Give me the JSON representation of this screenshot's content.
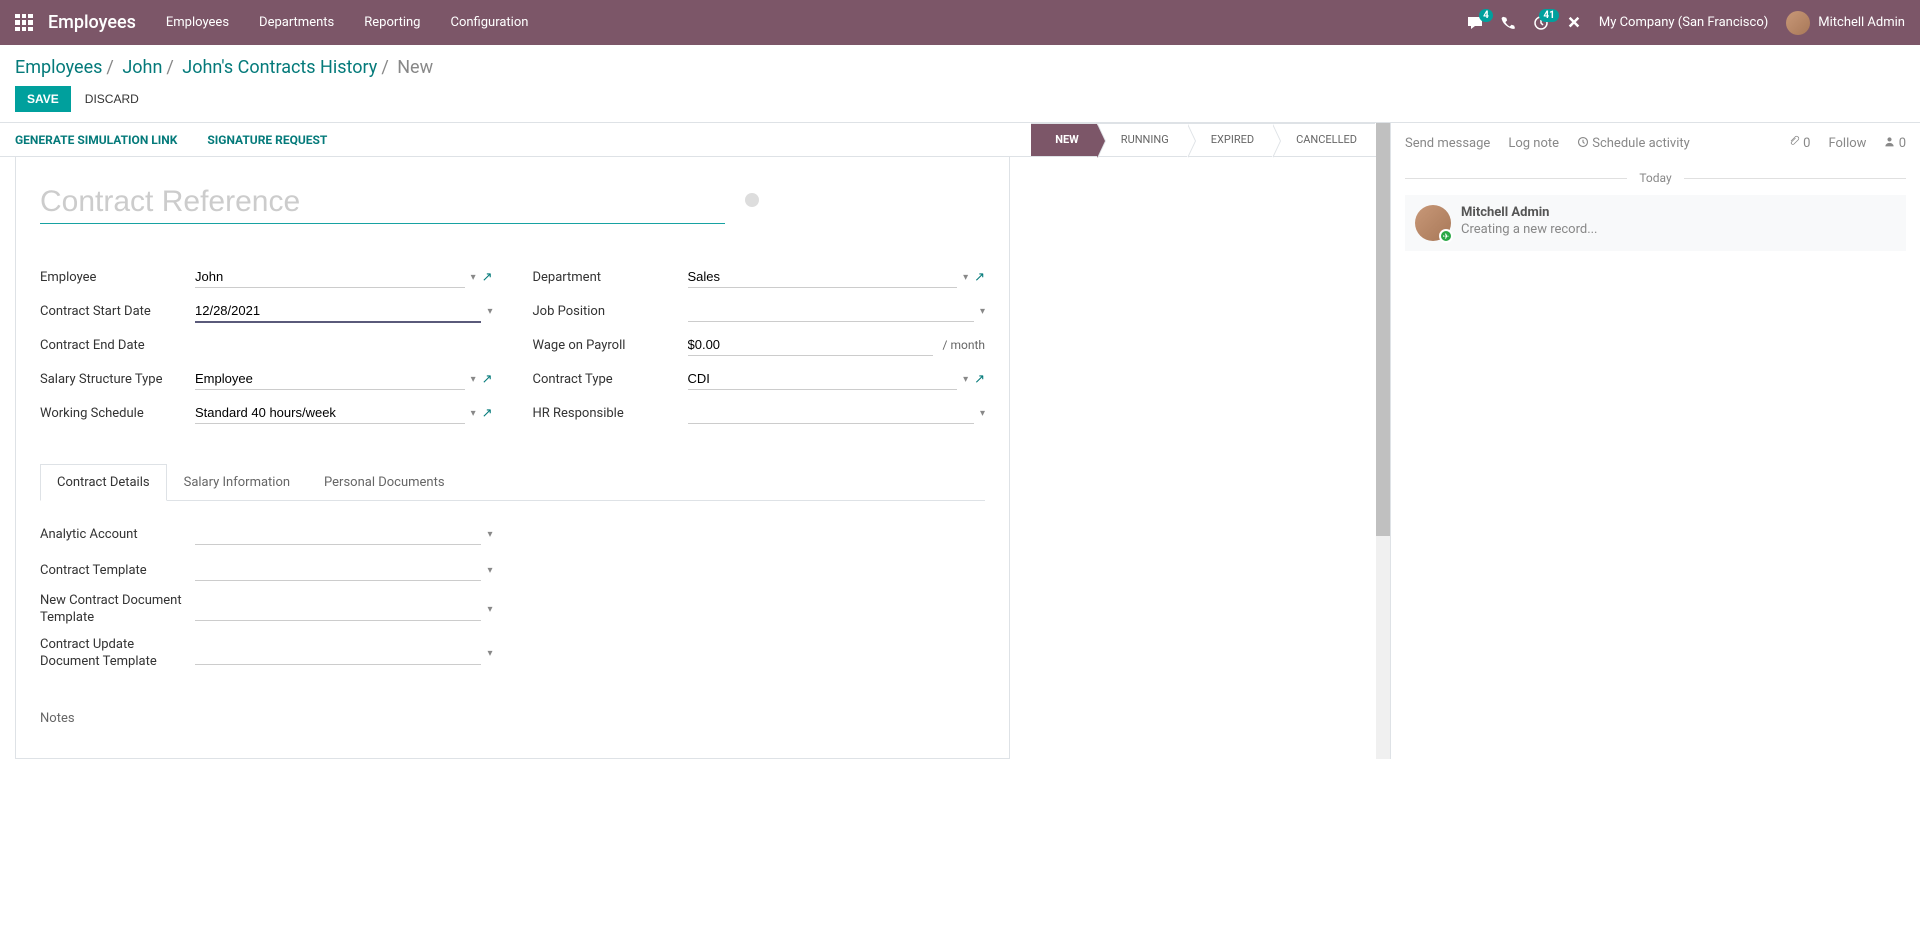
{
  "nav": {
    "module": "Employees",
    "menu": [
      "Employees",
      "Departments",
      "Reporting",
      "Configuration"
    ],
    "messages_badge": "4",
    "activities_badge": "41",
    "company": "My Company (San Francisco)",
    "user": "Mitchell Admin"
  },
  "breadcrumb": {
    "items": [
      "Employees",
      "John",
      "John's Contracts History"
    ],
    "current": "New"
  },
  "buttons": {
    "save": "SAVE",
    "discard": "DISCARD",
    "sim_link": "GENERATE SIMULATION LINK",
    "sig_request": "SIGNATURE REQUEST"
  },
  "status": {
    "steps": [
      "NEW",
      "RUNNING",
      "EXPIRED",
      "CANCELLED"
    ],
    "active": 0
  },
  "form": {
    "title_placeholder": "Contract Reference",
    "left": {
      "employee_label": "Employee",
      "employee_value": "John",
      "start_label": "Contract Start Date",
      "start_value": "12/28/2021",
      "end_label": "Contract End Date",
      "end_value": "",
      "struct_label": "Salary Structure Type",
      "struct_value": "Employee",
      "sched_label": "Working Schedule",
      "sched_value": "Standard 40 hours/week"
    },
    "right": {
      "dept_label": "Department",
      "dept_value": "Sales",
      "job_label": "Job Position",
      "job_value": "",
      "wage_label": "Wage on Payroll",
      "wage_value": "$0.00",
      "wage_suffix": "/ month",
      "ctype_label": "Contract Type",
      "ctype_value": "CDI",
      "hr_label": "HR Responsible",
      "hr_value": ""
    }
  },
  "tabs": {
    "labels": [
      "Contract Details",
      "Salary Information",
      "Personal Documents"
    ],
    "active": 0,
    "details": {
      "analytic_label": "Analytic Account",
      "template_label": "Contract Template",
      "newdoc_label": "New Contract Document Template",
      "update_label": "Contract Update Document Template",
      "notes_label": "Notes"
    }
  },
  "chatter": {
    "send": "Send message",
    "log": "Log note",
    "schedule": "Schedule activity",
    "attach_count": "0",
    "follow": "Follow",
    "follower_count": "0",
    "today": "Today",
    "msg_author": "Mitchell Admin",
    "msg_text": "Creating a new record..."
  }
}
